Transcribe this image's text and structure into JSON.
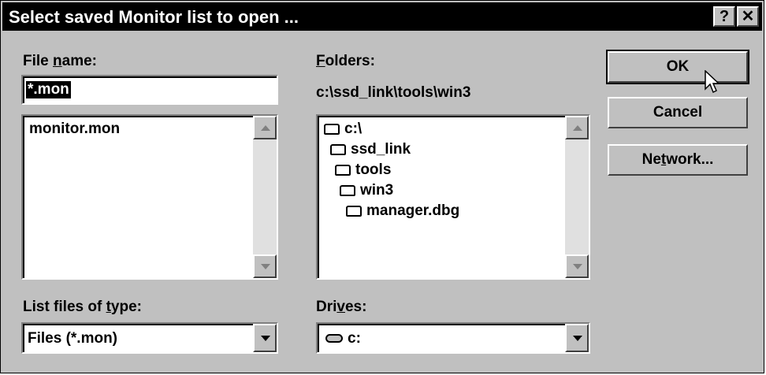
{
  "window": {
    "title": "Select saved Monitor list to open ...",
    "help_button": "?",
    "close_button": "✕"
  },
  "file_name": {
    "label_pre": "File ",
    "label_u": "n",
    "label_post": "ame:",
    "value": "*.mon"
  },
  "file_list": {
    "items": [
      "monitor.mon"
    ]
  },
  "folders": {
    "label_u": "F",
    "label_post": "olders:",
    "current_path": "c:\\ssd_link\\tools\\win3",
    "tree": [
      "c:\\",
      "ssd_link",
      "tools",
      "win3",
      "manager.dbg"
    ]
  },
  "file_type": {
    "label_pre": "List files of ",
    "label_u": "t",
    "label_post": "ype:",
    "selected": "Files (*.mon)"
  },
  "drives": {
    "label_pre": "Dri",
    "label_u": "v",
    "label_post": "es:",
    "selected": "c:"
  },
  "buttons": {
    "ok": "OK",
    "cancel": "Cancel",
    "network_pre": "Ne",
    "network_u": "t",
    "network_post": "work..."
  },
  "colors": {
    "face": "#c0c0c0",
    "titlebar": "#000000",
    "selection": "#000000"
  }
}
